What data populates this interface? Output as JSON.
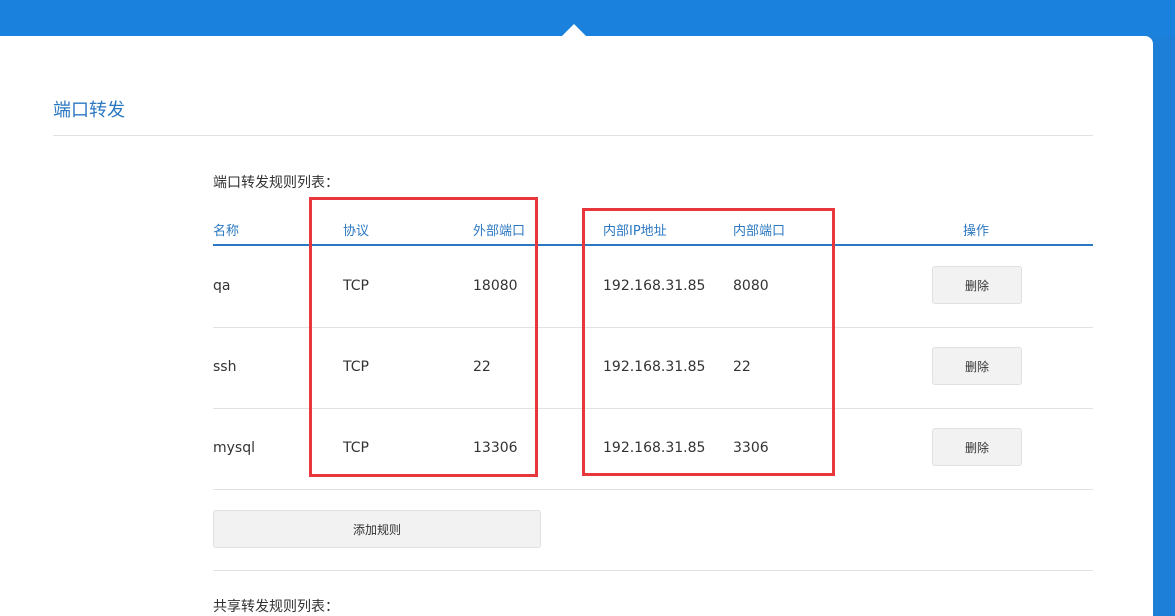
{
  "page": {
    "title": "端口转发",
    "section_label": "端口转发规则列表：",
    "next_section_label": "共享转发规则列表："
  },
  "table": {
    "headers": {
      "name": "名称",
      "protocol": "协议",
      "external_port": "外部端口",
      "internal_ip": "内部IP地址",
      "internal_port": "内部端口",
      "action": "操作"
    },
    "rows": [
      {
        "name": "qa",
        "protocol": "TCP",
        "external_port": "18080",
        "internal_ip": "192.168.31.85",
        "internal_port": "8080",
        "delete_label": "删除"
      },
      {
        "name": "ssh",
        "protocol": "TCP",
        "external_port": "22",
        "internal_ip": "192.168.31.85",
        "internal_port": "22",
        "delete_label": "删除"
      },
      {
        "name": "mysql",
        "protocol": "TCP",
        "external_port": "13306",
        "internal_ip": "192.168.31.85",
        "internal_port": "3306",
        "delete_label": "删除"
      }
    ]
  },
  "buttons": {
    "add_rule": "添加规则"
  },
  "colors": {
    "top_bar": "#1a82dd",
    "accent_text": "#2b78c2",
    "highlight_box": "#e8363d"
  }
}
